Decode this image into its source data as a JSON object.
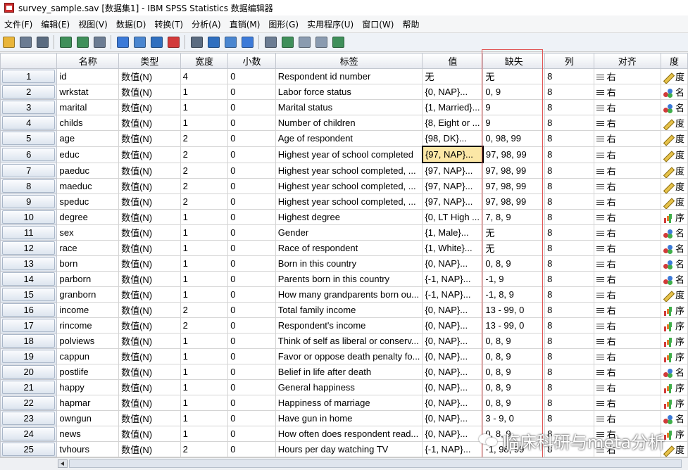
{
  "window": {
    "title": "survey_sample.sav [数据集1] - IBM SPSS Statistics 数据编辑器"
  },
  "menu": [
    "文件(F)",
    "编辑(E)",
    "视图(V)",
    "数据(D)",
    "转换(T)",
    "分析(A)",
    "直销(M)",
    "图形(G)",
    "实用程序(U)",
    "窗口(W)",
    "帮助"
  ],
  "toolbar": {
    "buttons": [
      "open-icon",
      "save-icon",
      "print-icon",
      "dialog-recall-icon",
      "undo-icon",
      "redo-icon",
      "goto-case-icon",
      "goto-variable-icon",
      "variables-icon",
      "run-descriptives-icon",
      "find-icon",
      "insert-cases-icon",
      "insert-variable-icon",
      "split-file-icon",
      "weight-cases-icon",
      "select-cases-icon",
      "value-labels-icon",
      "use-sets-icon",
      "spelling-icon"
    ]
  },
  "grid": {
    "columns": [
      "名称",
      "类型",
      "宽度",
      "小数",
      "标签",
      "值",
      "缺失",
      "列",
      "对齐",
      "度"
    ],
    "rows": [
      {
        "num": "1",
        "name": "id",
        "type": "数值(N)",
        "width": "4",
        "dec": "0",
        "label": "Respondent id number",
        "values": "无",
        "missing": "无",
        "col": "8",
        "align": "右",
        "measure": "度",
        "mtype": "scale"
      },
      {
        "num": "2",
        "name": "wrkstat",
        "type": "数值(N)",
        "width": "1",
        "dec": "0",
        "label": "Labor force status",
        "values": "{0, NAP}...",
        "missing": "0, 9",
        "col": "8",
        "align": "右",
        "measure": "名",
        "mtype": "nominal"
      },
      {
        "num": "3",
        "name": "marital",
        "type": "数值(N)",
        "width": "1",
        "dec": "0",
        "label": "Marital status",
        "values": "{1, Married}...",
        "missing": "9",
        "col": "8",
        "align": "右",
        "measure": "名",
        "mtype": "nominal"
      },
      {
        "num": "4",
        "name": "childs",
        "type": "数值(N)",
        "width": "1",
        "dec": "0",
        "label": "Number of children",
        "values": "{8, Eight or ...",
        "missing": "9",
        "col": "8",
        "align": "右",
        "measure": "度",
        "mtype": "scale"
      },
      {
        "num": "5",
        "name": "age",
        "type": "数值(N)",
        "width": "2",
        "dec": "0",
        "label": "Age of respondent",
        "values": "{98, DK}...",
        "missing": "0, 98, 99",
        "col": "8",
        "align": "右",
        "measure": "度",
        "mtype": "scale"
      },
      {
        "num": "6",
        "name": "educ",
        "type": "数值(N)",
        "width": "2",
        "dec": "0",
        "label": "Highest year of school completed",
        "values": "{97, NAP}...",
        "missing": "97, 98, 99",
        "col": "8",
        "align": "右",
        "measure": "度",
        "mtype": "scale"
      },
      {
        "num": "7",
        "name": "paeduc",
        "type": "数值(N)",
        "width": "2",
        "dec": "0",
        "label": "Highest year school completed, ...",
        "values": "{97, NAP}...",
        "missing": "97, 98, 99",
        "col": "8",
        "align": "右",
        "measure": "度",
        "mtype": "scale"
      },
      {
        "num": "8",
        "name": "maeduc",
        "type": "数值(N)",
        "width": "2",
        "dec": "0",
        "label": "Highest year school completed, ...",
        "values": "{97, NAP}...",
        "missing": "97, 98, 99",
        "col": "8",
        "align": "右",
        "measure": "度",
        "mtype": "scale"
      },
      {
        "num": "9",
        "name": "speduc",
        "type": "数值(N)",
        "width": "2",
        "dec": "0",
        "label": "Highest year school completed, ...",
        "values": "{97, NAP}...",
        "missing": "97, 98, 99",
        "col": "8",
        "align": "右",
        "measure": "度",
        "mtype": "scale"
      },
      {
        "num": "10",
        "name": "degree",
        "type": "数值(N)",
        "width": "1",
        "dec": "0",
        "label": "Highest degree",
        "values": "{0, LT High ...",
        "missing": "7, 8, 9",
        "col": "8",
        "align": "右",
        "measure": "序",
        "mtype": "ordinal"
      },
      {
        "num": "11",
        "name": "sex",
        "type": "数值(N)",
        "width": "1",
        "dec": "0",
        "label": "Gender",
        "values": "{1, Male}...",
        "missing": "无",
        "col": "8",
        "align": "右",
        "measure": "名",
        "mtype": "nominal"
      },
      {
        "num": "12",
        "name": "race",
        "type": "数值(N)",
        "width": "1",
        "dec": "0",
        "label": "Race of respondent",
        "values": "{1, White}...",
        "missing": "无",
        "col": "8",
        "align": "右",
        "measure": "名",
        "mtype": "nominal"
      },
      {
        "num": "13",
        "name": "born",
        "type": "数值(N)",
        "width": "1",
        "dec": "0",
        "label": "Born in this country",
        "values": "{0, NAP}...",
        "missing": "0, 8, 9",
        "col": "8",
        "align": "右",
        "measure": "名",
        "mtype": "nominal"
      },
      {
        "num": "14",
        "name": "parborn",
        "type": "数值(N)",
        "width": "1",
        "dec": "0",
        "label": "Parents born in this country",
        "values": "{-1, NAP}...",
        "missing": "-1, 9",
        "col": "8",
        "align": "右",
        "measure": "名",
        "mtype": "nominal"
      },
      {
        "num": "15",
        "name": "granborn",
        "type": "数值(N)",
        "width": "1",
        "dec": "0",
        "label": "How many grandparents born ou...",
        "values": "{-1, NAP}...",
        "missing": "-1, 8, 9",
        "col": "8",
        "align": "右",
        "measure": "度",
        "mtype": "scale"
      },
      {
        "num": "16",
        "name": "income",
        "type": "数值(N)",
        "width": "2",
        "dec": "0",
        "label": "Total family income",
        "values": "{0, NAP}...",
        "missing": "13 - 99, 0",
        "col": "8",
        "align": "右",
        "measure": "序",
        "mtype": "ordinal"
      },
      {
        "num": "17",
        "name": "rincome",
        "type": "数值(N)",
        "width": "2",
        "dec": "0",
        "label": "Respondent's income",
        "values": "{0, NAP}...",
        "missing": "13 - 99, 0",
        "col": "8",
        "align": "右",
        "measure": "序",
        "mtype": "ordinal"
      },
      {
        "num": "18",
        "name": "polviews",
        "type": "数值(N)",
        "width": "1",
        "dec": "0",
        "label": "Think of self as liberal or conserv...",
        "values": "{0, NAP}...",
        "missing": "0, 8, 9",
        "col": "8",
        "align": "右",
        "measure": "序",
        "mtype": "ordinal"
      },
      {
        "num": "19",
        "name": "cappun",
        "type": "数值(N)",
        "width": "1",
        "dec": "0",
        "label": "Favor or oppose death penalty fo...",
        "values": "{0, NAP}...",
        "missing": "0, 8, 9",
        "col": "8",
        "align": "右",
        "measure": "序",
        "mtype": "ordinal"
      },
      {
        "num": "20",
        "name": "postlife",
        "type": "数值(N)",
        "width": "1",
        "dec": "0",
        "label": "Belief in life after death",
        "values": "{0, NAP}...",
        "missing": "0, 8, 9",
        "col": "8",
        "align": "右",
        "measure": "名",
        "mtype": "nominal"
      },
      {
        "num": "21",
        "name": "happy",
        "type": "数值(N)",
        "width": "1",
        "dec": "0",
        "label": "General happiness",
        "values": "{0, NAP}...",
        "missing": "0, 8, 9",
        "col": "8",
        "align": "右",
        "measure": "序",
        "mtype": "ordinal"
      },
      {
        "num": "22",
        "name": "hapmar",
        "type": "数值(N)",
        "width": "1",
        "dec": "0",
        "label": "Happiness of marriage",
        "values": "{0, NAP}...",
        "missing": "0, 8, 9",
        "col": "8",
        "align": "右",
        "measure": "序",
        "mtype": "ordinal"
      },
      {
        "num": "23",
        "name": "owngun",
        "type": "数值(N)",
        "width": "1",
        "dec": "0",
        "label": "Have gun in home",
        "values": "{0, NAP}...",
        "missing": "3 - 9, 0",
        "col": "8",
        "align": "右",
        "measure": "名",
        "mtype": "nominal"
      },
      {
        "num": "24",
        "name": "news",
        "type": "数值(N)",
        "width": "1",
        "dec": "0",
        "label": "How often does respondent read...",
        "values": "{0, NAP}...",
        "missing": "0, 8, 9",
        "col": "8",
        "align": "右",
        "measure": "序",
        "mtype": "ordinal"
      },
      {
        "num": "25",
        "name": "tvhours",
        "type": "数值(N)",
        "width": "2",
        "dec": "0",
        "label": "Hours per day watching TV",
        "values": "{-1, NAP}...",
        "missing": "-1, 98, 99",
        "col": "8",
        "align": "右",
        "measure": "度",
        "mtype": "scale"
      }
    ],
    "selected": {
      "row": 5,
      "column": "values"
    }
  },
  "watermark": {
    "text": "临床科研与meta分析"
  },
  "colors": {
    "selection": "#fbe7a6",
    "highlight_box": "#e05252",
    "header_top": "#ffffff",
    "header_bottom": "#e6e9ef"
  }
}
